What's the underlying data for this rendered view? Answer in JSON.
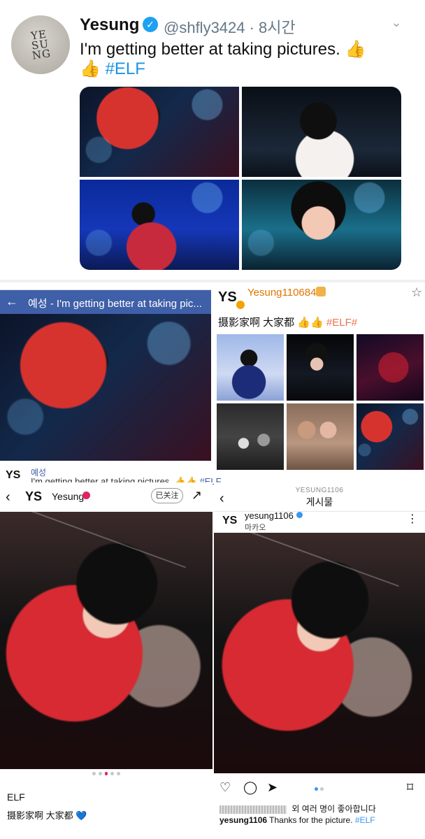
{
  "tweet": {
    "avatar_text": "YE\nSU\nNG",
    "name": "Yesung",
    "handle_time": "@shfly3424 · 8시간",
    "text_line1": "I'm getting better at taking pictures. 👍",
    "text_line2_prefix": "👍",
    "hashtag": "#ELF"
  },
  "facebook": {
    "title": "예성 - I'm getting better at taking pic...",
    "logo": "YS",
    "username": "예성",
    "message": "I'm getting better at taking pictures. 👍👍",
    "hashtag": "#ELF"
  },
  "weibo": {
    "logo": "YS",
    "username": "Yesung110684",
    "text": "摄影家啊 大家都 👍👍",
    "hashtag": "#ELF#"
  },
  "instagram_left": {
    "logo": "YS",
    "name": "Yesung",
    "follow_label": "已关注",
    "first_line": "ELF",
    "caption": "摄影家啊 大家都",
    "heart": "💙"
  },
  "instagram_right": {
    "username": "YESUNG1106",
    "title": "게시물",
    "logo": "YS",
    "post_name": "yesung1106",
    "location": "마카오",
    "likes_text": "외 여러 명이 좋아합니다",
    "caption_user": "yesung1106",
    "caption_text": "Thanks for the picture.",
    "hashtag": "#ELF"
  }
}
